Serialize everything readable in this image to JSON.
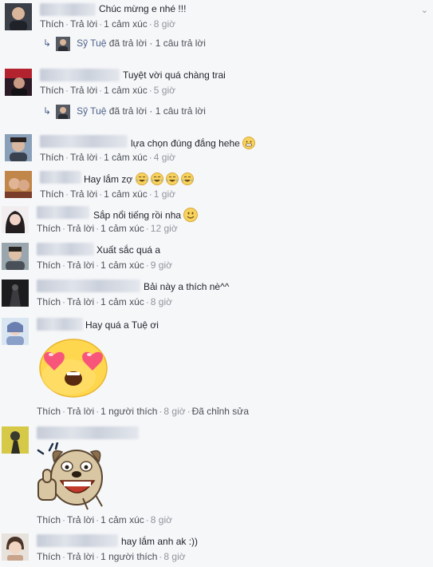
{
  "like_label": "Thích",
  "reply_label": "Trả lời",
  "sep": "·",
  "reply_thread": {
    "name": "Sỹ Tuệ",
    "action": "đã trả lời",
    "count": "1 câu trả lời"
  },
  "comments": [
    {
      "text": "Chúc mừng e nhé !!!",
      "reactions": "1 cảm xúc",
      "time": "8 giờ"
    },
    {
      "text": "Tuyệt vời quá chàng trai",
      "reactions": "1 cảm xúc",
      "time": "5 giờ"
    },
    {
      "text": "lựa chọn đúng đắng hehe",
      "reactions": "1 cảm xúc",
      "time": "4 giờ"
    },
    {
      "text": "Hay lắm zợ",
      "reactions": "1 cảm xúc",
      "time": "1 giờ"
    },
    {
      "text": "Sắp nổi tiếng rồi nha",
      "reactions": "1 cảm xúc",
      "time": "12 giờ"
    },
    {
      "text": "Xuất sắc quá a",
      "reactions": "1 cảm xúc",
      "time": "9 giờ"
    },
    {
      "text": "Bải này a thích nè^^",
      "reactions": "1 cảm xúc",
      "time": "8 giờ"
    },
    {
      "text": "Hay quá a Tuệ ơi",
      "reactions": "1 người thích",
      "time": "8 giờ",
      "edited": "Đã chỉnh sửa"
    },
    {
      "text": "",
      "reactions": "1 cảm xúc",
      "time": "8 giờ"
    },
    {
      "text": "hay lắm anh ak :))",
      "reactions": "1 người thích",
      "time": "8 giờ"
    }
  ],
  "colors": {
    "link": "#4b5f8a",
    "meta": "#90949c",
    "text": "#1d2129",
    "background": "#f6f7f9"
  },
  "icons": [
    "chevron-down-icon",
    "reply-arrow-icon",
    "grinning-emoji-icon",
    "tears-of-joy-emoji-icon",
    "smiley-emoji-icon",
    "heart-eyes-sticker",
    "thumbs-up-dog-sticker"
  ]
}
